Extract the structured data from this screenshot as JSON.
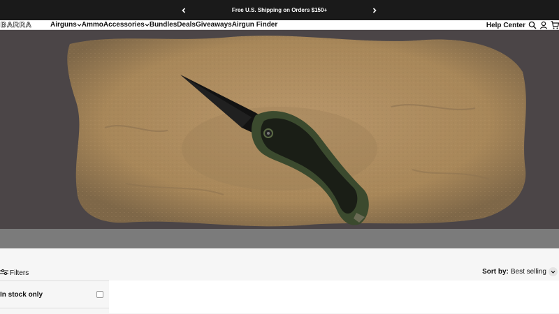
{
  "announcement": {
    "text": "Free U.S. Shipping on Orders $150+"
  },
  "header": {
    "logo": "BARRA",
    "nav": [
      {
        "label": "Airguns",
        "dropdown": true
      },
      {
        "label": "Ammo",
        "dropdown": false
      },
      {
        "label": "Accessories",
        "dropdown": true
      },
      {
        "label": "Bundles",
        "dropdown": false
      },
      {
        "label": "Deals",
        "dropdown": false
      },
      {
        "label": "Giveaways",
        "dropdown": false
      },
      {
        "label": "Airgun Finder",
        "dropdown": false
      }
    ],
    "help_center": "Help Center",
    "icons": [
      "search-icon",
      "account-icon",
      "cart-icon"
    ]
  },
  "hero": {
    "image": "black folding knife with green handle on sand"
  },
  "toolbar": {
    "filters_label": "Filters",
    "sort_label": "Sort by:",
    "sort_value": "Best selling"
  },
  "sidebar": {
    "in_stock_label": "In stock only"
  },
  "colors": {
    "announcement_bg": "#1a1a1a",
    "band": "#7b7b7b",
    "sand": "#b08f63",
    "knife_handle": "#3b4a2e"
  }
}
